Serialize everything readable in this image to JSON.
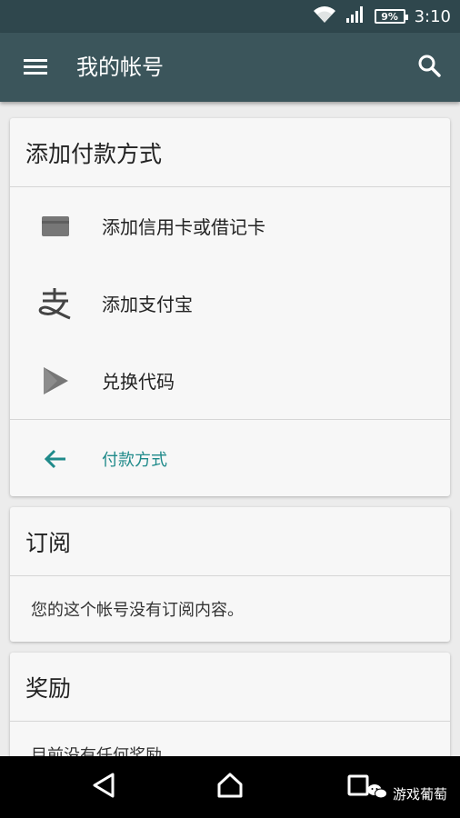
{
  "status_bar": {
    "battery": "9%",
    "time": "3:10"
  },
  "app_bar": {
    "title": "我的帐号"
  },
  "payment_card": {
    "header": "添加付款方式",
    "items": [
      {
        "label": "添加信用卡或借记卡",
        "icon": "credit-card-icon"
      },
      {
        "label": "添加支付宝",
        "icon": "alipay-icon"
      },
      {
        "label": "兑换代码",
        "icon": "play-store-icon"
      }
    ],
    "back_link": "付款方式"
  },
  "subscriptions_card": {
    "header": "订阅",
    "body": "您的这个帐号没有订阅内容。"
  },
  "rewards_card": {
    "header": "奖励",
    "body": "目前没有任何奖励。"
  },
  "watermark": {
    "text": "游戏葡萄"
  },
  "colors": {
    "app_bar": "#3b555b",
    "status_bar": "#2f474d",
    "accent": "#1f8a8a",
    "background": "#ececec",
    "card": "#f7f7f7"
  }
}
